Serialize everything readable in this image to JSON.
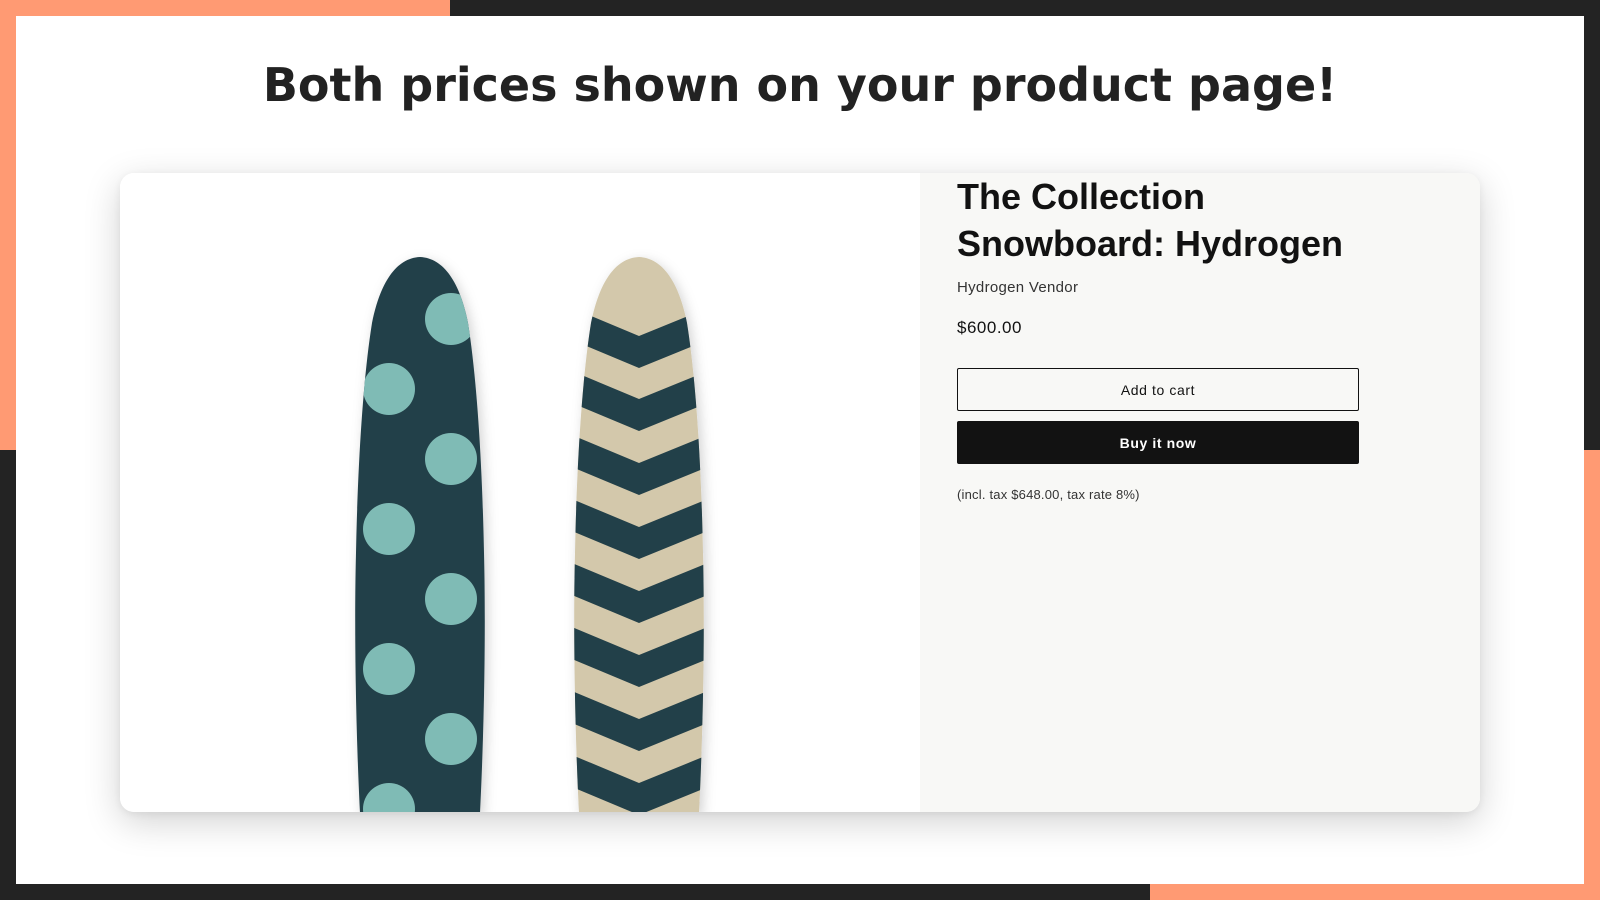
{
  "banner": {
    "headline": "Both prices shown on your product page!"
  },
  "product": {
    "title": "The Collection Snowboard: Hydrogen",
    "vendor": "Hydrogen Vendor",
    "price": "$600.00",
    "add_to_cart_label": "Add to cart",
    "buy_now_label": "Buy it now",
    "tax_note": "(incl. tax $648.00, tax rate 8%)"
  },
  "colors": {
    "accent": "#ff9a73",
    "frame": "#232323",
    "board_dark": "#233f48",
    "board_dots": "#7fbbb5",
    "board_beige": "#d3c8ab",
    "button_dark": "#121212"
  },
  "icons": {
    "image": "snowboard-pair-image"
  }
}
